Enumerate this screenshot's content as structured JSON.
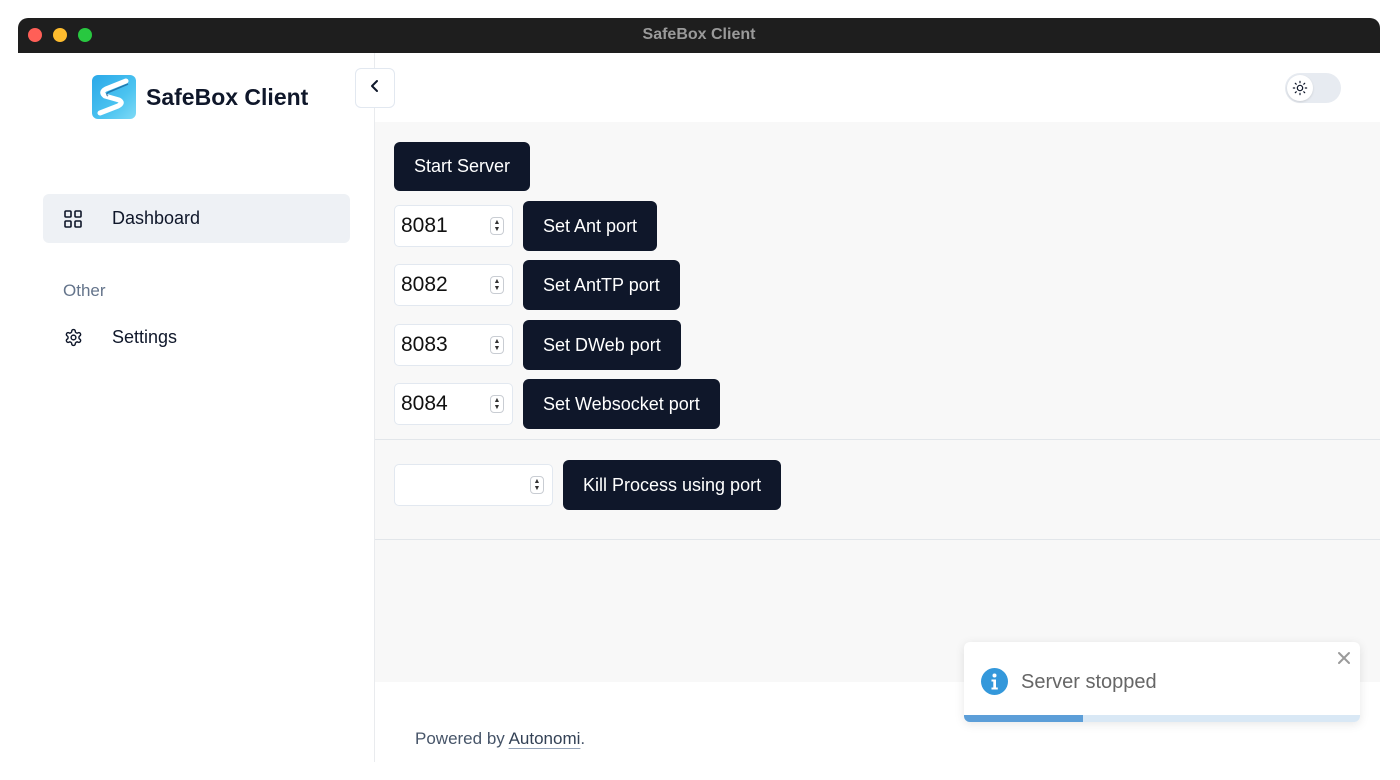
{
  "window": {
    "title": "SafeBox Client"
  },
  "sidebar": {
    "brand": "SafeBox Client",
    "items": [
      {
        "label": "Dashboard",
        "icon": "grid-icon",
        "active": true
      }
    ],
    "section_label": "Other",
    "other_items": [
      {
        "label": "Settings",
        "icon": "gear-icon"
      }
    ]
  },
  "header": {
    "theme_toggle": {
      "icon": "sun-icon",
      "mode": "light"
    }
  },
  "main": {
    "start_button": "Start Server",
    "ports": [
      {
        "value": "8081",
        "button": "Set Ant port"
      },
      {
        "value": "8082",
        "button": "Set AntTP port"
      },
      {
        "value": "8083",
        "button": "Set DWeb port"
      },
      {
        "value": "8084",
        "button": "Set Websocket port"
      }
    ],
    "kill": {
      "value": "",
      "button": "Kill Process using port"
    }
  },
  "footer": {
    "prefix": "Powered by ",
    "link": "Autonomi",
    "suffix": "."
  },
  "toast": {
    "message": "Server stopped",
    "icon": "info-icon",
    "progress": 0.3,
    "color": "#3498db"
  },
  "colors": {
    "primary": "#0f172a",
    "content_bg": "#f8f8f8",
    "active_nav": "#eef1f5",
    "info": "#3498db"
  }
}
